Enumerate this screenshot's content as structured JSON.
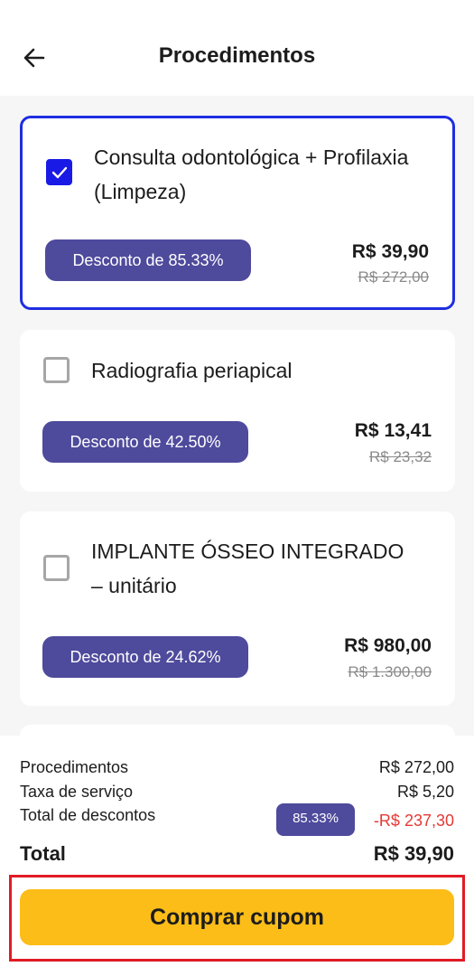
{
  "header": {
    "title": "Procedimentos",
    "back_icon": "arrow-left-icon"
  },
  "procedures": [
    {
      "name": "Consulta odontológica + Profilaxia (Limpeza)",
      "discount_label": "Desconto de 85.33%",
      "price": "R$ 39,90",
      "old_price": "R$ 272,00",
      "checked": true
    },
    {
      "name": "Radiografia periapical",
      "discount_label": "Desconto de 42.50%",
      "price": "R$ 13,41",
      "old_price": "R$ 23,32",
      "checked": false
    },
    {
      "name": "IMPLANTE ÓSSEO INTEGRADO – unitário",
      "discount_label": "Desconto de 24.62%",
      "price": "R$ 980,00",
      "old_price": "R$ 1.300,00",
      "checked": false
    }
  ],
  "summary": {
    "procedures_label": "Procedimentos",
    "procedures_value": "R$ 272,00",
    "fee_label": "Taxa de serviço",
    "fee_value": "R$ 5,20",
    "discount_label": "Total de descontos",
    "discount_badge": "85.33%",
    "discount_value": "-R$ 237,30",
    "total_label": "Total",
    "total_value": "R$ 39,90"
  },
  "buy_button": {
    "label": "Comprar cupom"
  },
  "colors": {
    "accent": "#1a1ae6",
    "badge": "#4e4a9c",
    "button": "#fcbd18",
    "negative": "#e53935",
    "highlight": "#e01b24"
  }
}
